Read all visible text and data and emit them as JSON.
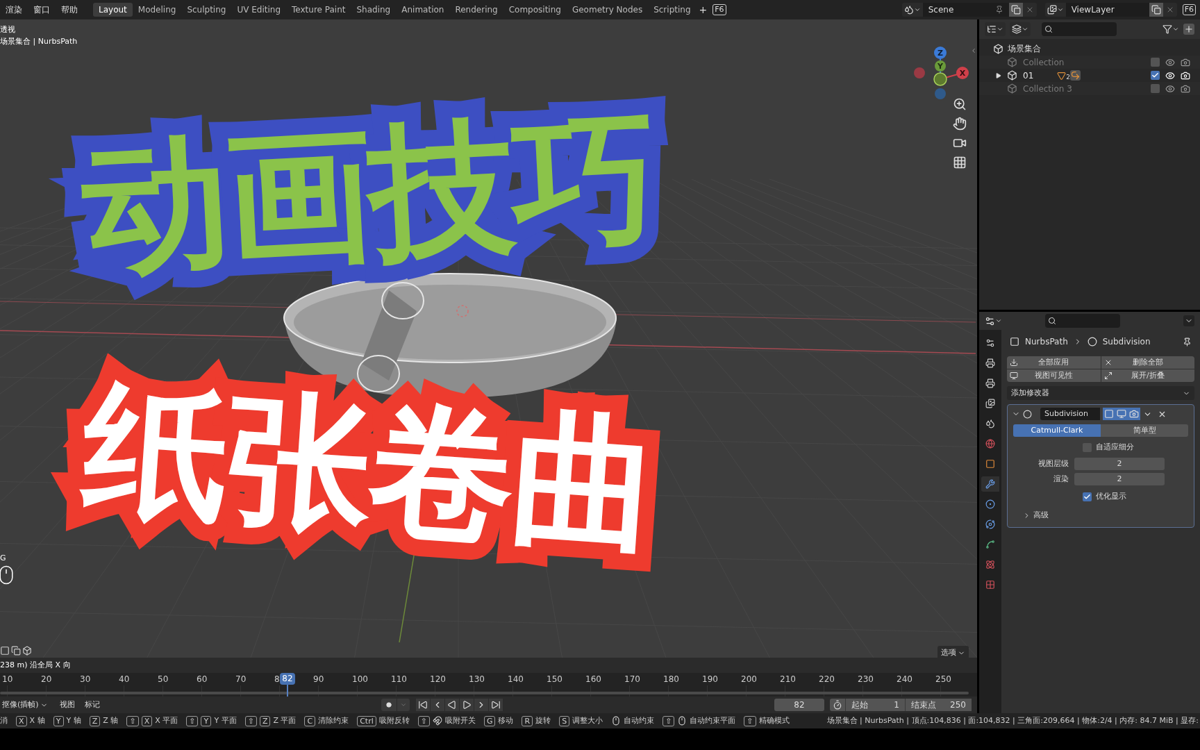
{
  "menu": [
    "渲染",
    "窗口",
    "帮助"
  ],
  "workspaces": [
    {
      "label": "Layout",
      "selected": true
    },
    {
      "label": "Modeling",
      "selected": false
    },
    {
      "label": "Sculpting",
      "selected": false
    },
    {
      "label": "UV Editing",
      "selected": false
    },
    {
      "label": "Texture Paint",
      "selected": false
    },
    {
      "label": "Shading",
      "selected": false
    },
    {
      "label": "Animation",
      "selected": false
    },
    {
      "label": "Rendering",
      "selected": false
    },
    {
      "label": "Compositing",
      "selected": false
    },
    {
      "label": "Geometry Nodes",
      "selected": false
    },
    {
      "label": "Scripting",
      "selected": false
    }
  ],
  "add_workspace": "+",
  "workspace_hotkey": "F6",
  "scene": "Scene",
  "view_layer": "ViewLayer",
  "window_hotkey": "F6",
  "viewport": {
    "view_name": "透视",
    "object_path": "场景集合 | NurbsPath",
    "gizmo": [
      "Z",
      "Y",
      "X"
    ],
    "title": "动画技巧",
    "subtitle": "纸张卷曲",
    "edge_key": "G",
    "options": "选项",
    "operator_status": "238 m) 沿全局 X 向"
  },
  "timeline": {
    "ticks": [
      "10",
      "20",
      "30",
      "40",
      "50",
      "60",
      "70",
      "8",
      "90",
      "100",
      "110",
      "120",
      "130",
      "140",
      "150",
      "160",
      "170",
      "180",
      "190",
      "200",
      "210",
      "220",
      "230",
      "240",
      "250"
    ],
    "current_frame": "82",
    "menus": [
      "抠像(插帧)",
      "视图",
      "标记"
    ],
    "frame": "82",
    "start_label": "起始",
    "start": "1",
    "end_label": "结束点",
    "end": "250"
  },
  "outliner": {
    "root": "场景集合",
    "items": [
      {
        "name": "Collection",
        "checked": false
      },
      {
        "name": "01",
        "checked": true,
        "expanded": false,
        "badge": "2"
      },
      {
        "name": "Collection 3",
        "checked": false
      }
    ]
  },
  "properties": {
    "tabs": [
      {
        "selected": false
      },
      {
        "selected": false
      },
      {
        "selected": false
      },
      {
        "selected": false
      },
      {
        "selected": false
      },
      {
        "selected": false
      },
      {
        "selected": false
      },
      {
        "selected": true
      },
      {
        "selected": false
      },
      {
        "selected": false
      },
      {
        "selected": false
      },
      {
        "selected": false
      },
      {
        "selected": false
      }
    ],
    "breadcrumb": [
      "NurbsPath",
      "Subdivision"
    ],
    "actions": [
      "全部应用",
      "删除全部",
      "视图可见性",
      "展开/折叠"
    ],
    "add_modifier": "添加修改器",
    "modifier": {
      "name": "Subdivision",
      "expanded": true,
      "modes": [
        {
          "label": "Catmull-Clark",
          "selected": true
        },
        {
          "label": "简单型",
          "selected": false
        }
      ],
      "adaptive": {
        "label": "自适应细分",
        "checked": false
      },
      "fields": [
        {
          "label": "视图层级",
          "value": "2"
        },
        {
          "label": "渲染",
          "value": "2"
        }
      ],
      "optimal": {
        "label": "优化显示",
        "checked": true
      },
      "advanced": {
        "label": "高级",
        "expanded": false
      }
    }
  },
  "status_bar": {
    "hints": [
      {
        "label": "消"
      },
      {
        "keys": [
          {
            "kind": "key",
            "label": "X"
          }
        ],
        "label": "X 轴"
      },
      {
        "keys": [
          {
            "kind": "key",
            "label": "Y"
          }
        ],
        "label": "Y 轴"
      },
      {
        "keys": [
          {
            "kind": "key",
            "label": "Z"
          }
        ],
        "label": "Z 轴"
      },
      {
        "keys": [
          {
            "kind": "key",
            "label": "⇧"
          },
          {
            "kind": "key",
            "label": "X"
          }
        ],
        "label": "X 平面"
      },
      {
        "keys": [
          {
            "kind": "key",
            "label": "⇧"
          },
          {
            "kind": "key",
            "label": "Y"
          }
        ],
        "label": "Y 平面"
      },
      {
        "keys": [
          {
            "kind": "key",
            "label": "⇧"
          },
          {
            "kind": "key",
            "label": "Z"
          }
        ],
        "label": "Z 平面"
      },
      {
        "keys": [
          {
            "kind": "key",
            "label": "C"
          }
        ],
        "label": "清除约束"
      },
      {
        "keys": [
          {
            "kind": "key",
            "label": "Ctrl"
          }
        ],
        "label": "吸附反转"
      },
      {
        "keys": [
          {
            "kind": "key",
            "label": "⇧"
          },
          {
            "kind": "snap"
          }
        ],
        "label": "吸附开关"
      },
      {
        "keys": [
          {
            "kind": "key",
            "label": "G"
          }
        ],
        "label": "移动"
      },
      {
        "keys": [
          {
            "kind": "key",
            "label": "R"
          }
        ],
        "label": "旋转"
      },
      {
        "keys": [
          {
            "kind": "key",
            "label": "S"
          }
        ],
        "label": "调整大小"
      },
      {
        "keys": [
          {
            "kind": "mouse"
          }
        ],
        "label": "自动约束"
      },
      {
        "keys": [
          {
            "kind": "key",
            "label": "⇧"
          },
          {
            "kind": "mouse"
          }
        ],
        "label": "自动约束平面"
      },
      {
        "keys": [
          {
            "kind": "key",
            "label": "⇧"
          }
        ],
        "label": "精确模式"
      }
    ],
    "stats": "场景集合 | NurbsPath | 顶点:104,836 | 面:104,832 | 三角面:209,664 | 物体:2/4 | 内存: 84.7 MiB | 显存:"
  }
}
